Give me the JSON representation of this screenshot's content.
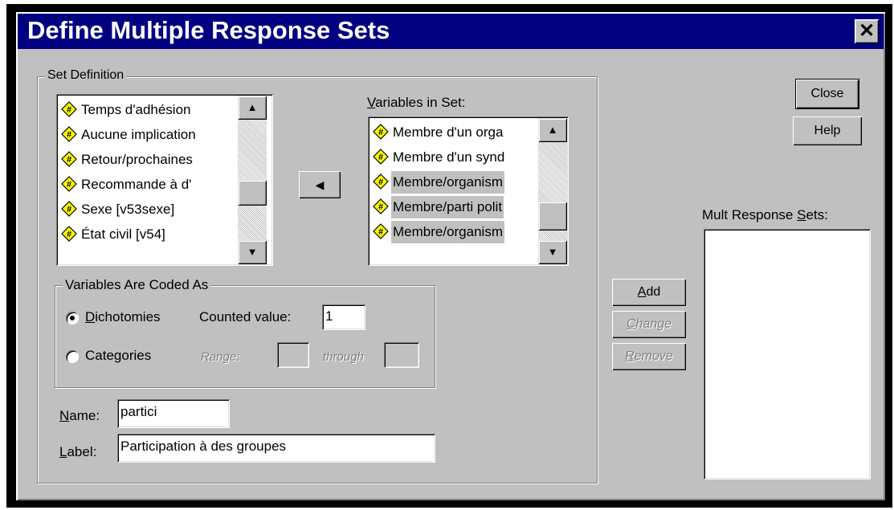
{
  "dialog": {
    "title": "Define Multiple Response Sets",
    "close_glyph": "✕"
  },
  "set_definition": {
    "legend": "Set Definition",
    "source_variables": [
      {
        "label": "Temps d'adhésion",
        "icon": "numeric-variable-icon"
      },
      {
        "label": "Aucune implication",
        "icon": "numeric-variable-icon"
      },
      {
        "label": "Retour/prochaines",
        "icon": "numeric-variable-icon"
      },
      {
        "label": "Recommande à d'",
        "icon": "numeric-variable-icon"
      },
      {
        "label": "Sexe [v53sexe]",
        "icon": "numeric-variable-icon"
      },
      {
        "label": "État civil [v54]",
        "icon": "numeric-variable-icon"
      }
    ],
    "move_button_glyph": "◀",
    "variables_in_set_label_prefix": "V",
    "variables_in_set_label_rest": "ariables in Set:",
    "variables_in_set": [
      {
        "label": "Membre d'un orga",
        "icon": "numeric-variable-icon",
        "selected": false
      },
      {
        "label": "Membre d'un synd",
        "icon": "numeric-variable-icon",
        "selected": false
      },
      {
        "label": "Membre/organism",
        "icon": "numeric-variable-icon",
        "selected": true
      },
      {
        "label": "Membre/parti polit",
        "icon": "numeric-variable-icon",
        "selected": true
      },
      {
        "label": "Membre/organism",
        "icon": "numeric-variable-icon",
        "selected": true
      }
    ],
    "coded_as": {
      "legend": "Variables Are Coded As",
      "dichotomies_prefix": "D",
      "dichotomies_rest": "ichotomies",
      "counted_value_label": "Counted value:",
      "counted_value": "1",
      "categories_label": "Categories",
      "range_label": "Range:",
      "through_label": "through",
      "selected_option": "Dichotomies"
    },
    "name_label_prefix": "N",
    "name_label_rest": "ame:",
    "name_value": "partici",
    "label_label_prefix": "L",
    "label_label_rest": "abel:",
    "label_value": "Participation à des groupes"
  },
  "buttons": {
    "close": "Close",
    "help": "Help",
    "add_prefix": "A",
    "add_rest": "dd",
    "change_prefix": "C",
    "change_rest": "hange",
    "remove_prefix": "R",
    "remove_rest": "emove"
  },
  "mult_response": {
    "label_prefix": "Mult Response ",
    "label_underlined": "S",
    "label_rest": "ets:",
    "items": []
  },
  "colors": {
    "title_bar": "#000080",
    "dialog_face": "#c0c0c0",
    "variable_icon": "#ffff00"
  }
}
